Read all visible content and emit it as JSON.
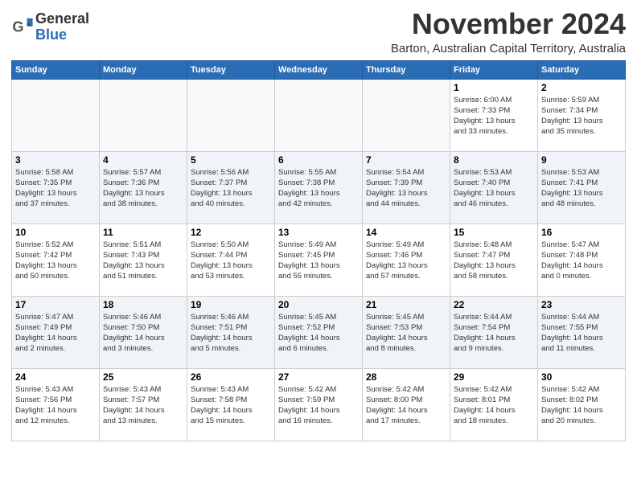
{
  "header": {
    "logo_general": "General",
    "logo_blue": "Blue",
    "month_title": "November 2024",
    "subtitle": "Barton, Australian Capital Territory, Australia"
  },
  "days_of_week": [
    "Sunday",
    "Monday",
    "Tuesday",
    "Wednesday",
    "Thursday",
    "Friday",
    "Saturday"
  ],
  "weeks": [
    [
      {
        "day": "",
        "info": ""
      },
      {
        "day": "",
        "info": ""
      },
      {
        "day": "",
        "info": ""
      },
      {
        "day": "",
        "info": ""
      },
      {
        "day": "",
        "info": ""
      },
      {
        "day": "1",
        "info": "Sunrise: 6:00 AM\nSunset: 7:33 PM\nDaylight: 13 hours\nand 33 minutes."
      },
      {
        "day": "2",
        "info": "Sunrise: 5:59 AM\nSunset: 7:34 PM\nDaylight: 13 hours\nand 35 minutes."
      }
    ],
    [
      {
        "day": "3",
        "info": "Sunrise: 5:58 AM\nSunset: 7:35 PM\nDaylight: 13 hours\nand 37 minutes."
      },
      {
        "day": "4",
        "info": "Sunrise: 5:57 AM\nSunset: 7:36 PM\nDaylight: 13 hours\nand 38 minutes."
      },
      {
        "day": "5",
        "info": "Sunrise: 5:56 AM\nSunset: 7:37 PM\nDaylight: 13 hours\nand 40 minutes."
      },
      {
        "day": "6",
        "info": "Sunrise: 5:55 AM\nSunset: 7:38 PM\nDaylight: 13 hours\nand 42 minutes."
      },
      {
        "day": "7",
        "info": "Sunrise: 5:54 AM\nSunset: 7:39 PM\nDaylight: 13 hours\nand 44 minutes."
      },
      {
        "day": "8",
        "info": "Sunrise: 5:53 AM\nSunset: 7:40 PM\nDaylight: 13 hours\nand 46 minutes."
      },
      {
        "day": "9",
        "info": "Sunrise: 5:53 AM\nSunset: 7:41 PM\nDaylight: 13 hours\nand 48 minutes."
      }
    ],
    [
      {
        "day": "10",
        "info": "Sunrise: 5:52 AM\nSunset: 7:42 PM\nDaylight: 13 hours\nand 50 minutes."
      },
      {
        "day": "11",
        "info": "Sunrise: 5:51 AM\nSunset: 7:43 PM\nDaylight: 13 hours\nand 51 minutes."
      },
      {
        "day": "12",
        "info": "Sunrise: 5:50 AM\nSunset: 7:44 PM\nDaylight: 13 hours\nand 53 minutes."
      },
      {
        "day": "13",
        "info": "Sunrise: 5:49 AM\nSunset: 7:45 PM\nDaylight: 13 hours\nand 55 minutes."
      },
      {
        "day": "14",
        "info": "Sunrise: 5:49 AM\nSunset: 7:46 PM\nDaylight: 13 hours\nand 57 minutes."
      },
      {
        "day": "15",
        "info": "Sunrise: 5:48 AM\nSunset: 7:47 PM\nDaylight: 13 hours\nand 58 minutes."
      },
      {
        "day": "16",
        "info": "Sunrise: 5:47 AM\nSunset: 7:48 PM\nDaylight: 14 hours\nand 0 minutes."
      }
    ],
    [
      {
        "day": "17",
        "info": "Sunrise: 5:47 AM\nSunset: 7:49 PM\nDaylight: 14 hours\nand 2 minutes."
      },
      {
        "day": "18",
        "info": "Sunrise: 5:46 AM\nSunset: 7:50 PM\nDaylight: 14 hours\nand 3 minutes."
      },
      {
        "day": "19",
        "info": "Sunrise: 5:46 AM\nSunset: 7:51 PM\nDaylight: 14 hours\nand 5 minutes."
      },
      {
        "day": "20",
        "info": "Sunrise: 5:45 AM\nSunset: 7:52 PM\nDaylight: 14 hours\nand 6 minutes."
      },
      {
        "day": "21",
        "info": "Sunrise: 5:45 AM\nSunset: 7:53 PM\nDaylight: 14 hours\nand 8 minutes."
      },
      {
        "day": "22",
        "info": "Sunrise: 5:44 AM\nSunset: 7:54 PM\nDaylight: 14 hours\nand 9 minutes."
      },
      {
        "day": "23",
        "info": "Sunrise: 5:44 AM\nSunset: 7:55 PM\nDaylight: 14 hours\nand 11 minutes."
      }
    ],
    [
      {
        "day": "24",
        "info": "Sunrise: 5:43 AM\nSunset: 7:56 PM\nDaylight: 14 hours\nand 12 minutes."
      },
      {
        "day": "25",
        "info": "Sunrise: 5:43 AM\nSunset: 7:57 PM\nDaylight: 14 hours\nand 13 minutes."
      },
      {
        "day": "26",
        "info": "Sunrise: 5:43 AM\nSunset: 7:58 PM\nDaylight: 14 hours\nand 15 minutes."
      },
      {
        "day": "27",
        "info": "Sunrise: 5:42 AM\nSunset: 7:59 PM\nDaylight: 14 hours\nand 16 minutes."
      },
      {
        "day": "28",
        "info": "Sunrise: 5:42 AM\nSunset: 8:00 PM\nDaylight: 14 hours\nand 17 minutes."
      },
      {
        "day": "29",
        "info": "Sunrise: 5:42 AM\nSunset: 8:01 PM\nDaylight: 14 hours\nand 18 minutes."
      },
      {
        "day": "30",
        "info": "Sunrise: 5:42 AM\nSunset: 8:02 PM\nDaylight: 14 hours\nand 20 minutes."
      }
    ]
  ]
}
